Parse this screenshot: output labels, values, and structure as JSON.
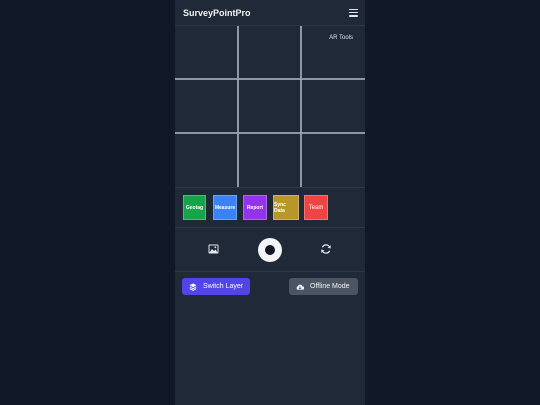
{
  "app": {
    "title": "SurveyPointPro",
    "menu_icon": "hamburger-menu-icon"
  },
  "viewfinder": {
    "ar_label": "AR Tools"
  },
  "tools": [
    {
      "label": "Geotag",
      "color": "#16a34a"
    },
    {
      "label": "Measure",
      "color": "#3b82f6"
    },
    {
      "label": "Report",
      "color": "#9333ea"
    },
    {
      "label": "Sync Data",
      "color": "#b8962a"
    },
    {
      "label": "Team",
      "color": "#ef4444"
    }
  ],
  "capture": {
    "gallery_icon": "image-gallery-icon",
    "shutter_icon": "shutter-button",
    "flip_icon": "refresh-icon"
  },
  "actions": {
    "switch_layer": {
      "label": "Switch Layer",
      "icon": "layers-icon",
      "color": "#4f46e5"
    },
    "offline_mode": {
      "label": "Offline Mode",
      "icon": "cloud-download-icon",
      "color": "#4b5563"
    }
  }
}
